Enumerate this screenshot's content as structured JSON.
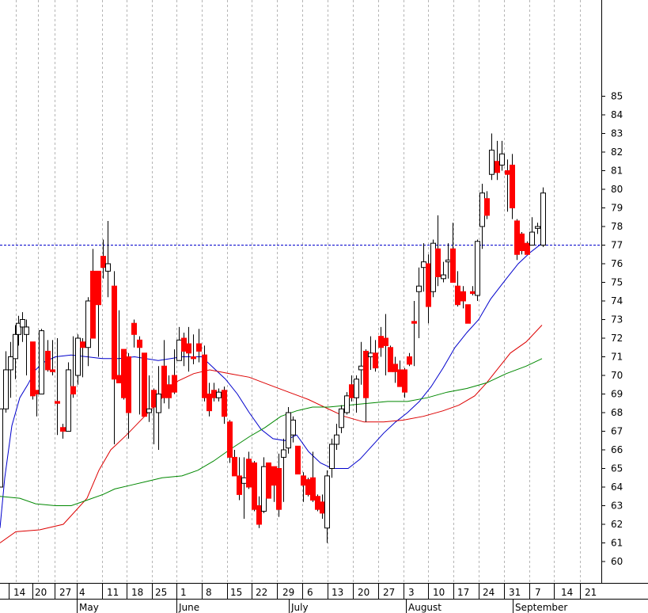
{
  "chart_data": {
    "type": "candlestick",
    "y_axis": {
      "side": "right",
      "range": [
        59,
        85.5
      ],
      "ticks": [
        60,
        61,
        62,
        63,
        64,
        65,
        66,
        67,
        68,
        69,
        70,
        71,
        72,
        73,
        74,
        75,
        76,
        77,
        78,
        79,
        80,
        81,
        82,
        83,
        84,
        85
      ]
    },
    "x_axis": {
      "ticks": [
        "14",
        "20",
        "27",
        "4",
        "11",
        "18",
        "25",
        "1",
        "8",
        "15",
        "22",
        "29",
        "6",
        "13",
        "20",
        "27",
        "3",
        "10",
        "17",
        "24",
        "31",
        "7",
        "14",
        "21"
      ],
      "months": [
        "May",
        "June",
        "July",
        "August",
        "September"
      ]
    },
    "reference_line": {
      "value": 77,
      "color": "#0000cc",
      "style": "dashed"
    },
    "series": [
      {
        "kind": "moving-average",
        "color": "#0000cc",
        "values": [
          [
            0,
            61.8
          ],
          [
            6,
            64.5
          ],
          [
            15,
            67.3
          ],
          [
            25,
            68.8
          ],
          [
            35,
            69.5
          ],
          [
            45,
            70.3
          ],
          [
            55,
            70.7
          ],
          [
            70,
            71.0
          ],
          [
            90,
            71.1
          ],
          [
            110,
            71.0
          ],
          [
            130,
            70.9
          ],
          [
            150,
            70.9
          ],
          [
            170,
            71.0
          ],
          [
            200,
            70.8
          ],
          [
            230,
            71.0
          ],
          [
            255,
            71.0
          ],
          [
            270,
            70.4
          ],
          [
            285,
            69.8
          ],
          [
            300,
            69.0
          ],
          [
            315,
            68.0
          ],
          [
            330,
            67.1
          ],
          [
            345,
            66.6
          ],
          [
            360,
            66.5
          ],
          [
            375,
            66.8
          ],
          [
            390,
            65.9
          ],
          [
            405,
            65.3
          ],
          [
            420,
            65.0
          ],
          [
            440,
            65.0
          ],
          [
            455,
            65.5
          ],
          [
            470,
            66.2
          ],
          [
            485,
            66.9
          ],
          [
            500,
            67.5
          ],
          [
            515,
            68.0
          ],
          [
            530,
            68.6
          ],
          [
            545,
            69.4
          ],
          [
            560,
            70.4
          ],
          [
            575,
            71.5
          ],
          [
            590,
            72.3
          ],
          [
            605,
            73.0
          ],
          [
            620,
            74.1
          ],
          [
            640,
            75.2
          ],
          [
            655,
            76.0
          ],
          [
            670,
            76.6
          ],
          [
            685,
            77.1
          ]
        ]
      },
      {
        "kind": "moving-average",
        "color": "#dd0000",
        "values": [
          [
            0,
            61.0
          ],
          [
            20,
            61.6
          ],
          [
            50,
            61.7
          ],
          [
            80,
            62.0
          ],
          [
            110,
            63.4
          ],
          [
            125,
            64.9
          ],
          [
            140,
            66.0
          ],
          [
            160,
            66.8
          ],
          [
            185,
            67.9
          ],
          [
            205,
            68.8
          ],
          [
            225,
            69.7
          ],
          [
            245,
            70.1
          ],
          [
            265,
            70.3
          ],
          [
            290,
            70.1
          ],
          [
            315,
            69.9
          ],
          [
            340,
            69.5
          ],
          [
            365,
            69.1
          ],
          [
            390,
            68.7
          ],
          [
            410,
            68.3
          ],
          [
            435,
            67.8
          ],
          [
            460,
            67.5
          ],
          [
            485,
            67.5
          ],
          [
            510,
            67.6
          ],
          [
            535,
            67.8
          ],
          [
            560,
            68.1
          ],
          [
            580,
            68.4
          ],
          [
            600,
            68.9
          ],
          [
            615,
            69.6
          ],
          [
            630,
            70.4
          ],
          [
            645,
            71.2
          ],
          [
            665,
            71.8
          ],
          [
            685,
            72.7
          ]
        ]
      },
      {
        "kind": "moving-average",
        "color": "#008800",
        "values": [
          [
            0,
            63.5
          ],
          [
            25,
            63.4
          ],
          [
            45,
            63.1
          ],
          [
            70,
            63.0
          ],
          [
            90,
            63.0
          ],
          [
            110,
            63.3
          ],
          [
            130,
            63.6
          ],
          [
            145,
            63.9
          ],
          [
            165,
            64.1
          ],
          [
            185,
            64.3
          ],
          [
            205,
            64.5
          ],
          [
            230,
            64.6
          ],
          [
            250,
            64.9
          ],
          [
            270,
            65.4
          ],
          [
            290,
            66.0
          ],
          [
            315,
            66.7
          ],
          [
            335,
            67.2
          ],
          [
            355,
            67.8
          ],
          [
            375,
            68.1
          ],
          [
            395,
            68.3
          ],
          [
            415,
            68.3
          ],
          [
            440,
            68.4
          ],
          [
            465,
            68.5
          ],
          [
            490,
            68.6
          ],
          [
            515,
            68.6
          ],
          [
            540,
            68.8
          ],
          [
            565,
            69.1
          ],
          [
            590,
            69.3
          ],
          [
            615,
            69.6
          ],
          [
            640,
            70.1
          ],
          [
            665,
            70.5
          ],
          [
            685,
            70.9
          ]
        ]
      }
    ],
    "candles": [
      [
        0,
        64,
        68.2,
        64,
        68.2
      ],
      [
        7,
        68.2,
        71.3,
        68.0,
        70.3
      ],
      [
        13,
        70.3,
        71.8,
        68.8,
        71.0
      ],
      [
        19,
        70.9,
        72.7,
        69.8,
        72.2
      ],
      [
        23,
        72.2,
        73.2,
        71.6,
        72.8
      ],
      [
        28,
        72.6,
        73.4,
        71.8,
        73.0
      ],
      [
        33,
        72.2,
        73.0,
        70.0,
        72.6
      ],
      [
        41,
        71.8,
        71.8,
        68.7,
        68.9
      ],
      [
        46,
        69.2,
        69.2,
        67.8,
        69.0
      ],
      [
        52,
        69.0,
        72.5,
        69.0,
        72.4
      ],
      [
        60,
        71.3,
        71.9,
        70.2,
        70.3
      ],
      [
        66,
        70.3,
        71.9,
        70.0,
        70.2
      ],
      [
        72,
        68.6,
        72.0,
        66.8,
        68.5
      ],
      [
        79,
        67.2,
        67.4,
        66.6,
        67.0
      ],
      [
        86,
        67.0,
        70.7,
        67.0,
        70.3
      ],
      [
        92,
        69.4,
        72.1,
        68.8,
        69.0
      ],
      [
        98,
        70.0,
        72.2,
        69.5,
        72.0
      ],
      [
        104,
        71.8,
        72.0,
        69.9,
        71.5
      ],
      [
        111,
        71.5,
        74.2,
        70.5,
        74.0
      ],
      [
        117,
        75.6,
        76.8,
        72.0,
        72.0
      ],
      [
        124,
        75.6,
        75.6,
        71.0,
        73.8
      ],
      [
        130,
        76.4,
        77.3,
        75.2,
        75.8
      ],
      [
        136,
        75.6,
        78.3,
        74.2,
        76.0
      ],
      [
        144,
        74.8,
        75.6,
        66.3,
        69.8
      ],
      [
        150,
        70.0,
        73.5,
        69.8,
        69.6
      ],
      [
        156,
        71.4,
        71.4,
        68.7,
        68.8
      ],
      [
        162,
        71.0,
        71.2,
        66.6,
        68.0
      ],
      [
        169,
        72.8,
        73.0,
        71.5,
        72.2
      ],
      [
        176,
        71.9,
        72.1,
        67.9,
        71.5
      ],
      [
        182,
        71.2,
        71.2,
        67.8,
        67.8
      ],
      [
        188,
        68.0,
        70.0,
        67.5,
        68.2
      ],
      [
        194,
        69.2,
        69.3,
        66.3,
        68.3
      ],
      [
        200,
        68.0,
        70.5,
        66.0,
        69.0
      ],
      [
        207,
        70.5,
        71.9,
        68.5,
        68.8
      ],
      [
        213,
        69.5,
        70.0,
        68.2,
        68.8
      ],
      [
        220,
        70.0,
        71.4,
        69.0,
        69.1
      ],
      [
        226,
        70.8,
        72.6,
        70.8,
        71.9
      ],
      [
        232,
        72.0,
        72.3,
        70.5,
        71.3
      ],
      [
        238,
        71.7,
        72.6,
        70.2,
        71.2
      ],
      [
        244,
        71.0,
        72.2,
        70.6,
        70.9
      ],
      [
        251,
        71.7,
        72.5,
        70.7,
        71.3
      ],
      [
        258,
        71.1,
        71.6,
        68.6,
        68.8
      ],
      [
        264,
        69.0,
        69.6,
        67.8,
        68.1
      ],
      [
        270,
        69.2,
        69.6,
        68.6,
        68.8
      ],
      [
        276,
        68.8,
        69.3,
        68.6,
        69.1
      ],
      [
        283,
        69.2,
        69.4,
        67.4,
        67.8
      ],
      [
        290,
        67.5,
        67.6,
        65.3,
        65.6
      ],
      [
        296,
        65.6,
        66.0,
        64.6,
        64.6
      ],
      [
        302,
        64.6,
        65.6,
        63.3,
        63.6
      ],
      [
        308,
        64.2,
        65.6,
        62.3,
        64.5
      ],
      [
        314,
        65.5,
        65.9,
        63.9,
        64.0
      ],
      [
        321,
        65.3,
        65.4,
        62.7,
        62.8
      ],
      [
        327,
        63.0,
        63.5,
        61.8,
        62.0
      ],
      [
        333,
        62.7,
        65.6,
        62.6,
        65.1
      ],
      [
        339,
        65.3,
        65.3,
        63.4,
        63.4
      ],
      [
        346,
        65.1,
        65.1,
        63.2,
        64.1
      ],
      [
        352,
        65.0,
        65.8,
        62.4,
        62.8
      ],
      [
        358,
        65.6,
        66.6,
        63.2,
        66.0
      ],
      [
        364,
        66.1,
        68.3,
        65.8,
        68.0
      ],
      [
        370,
        66.8,
        67.8,
        66.4,
        67.6
      ],
      [
        376,
        66.2,
        66.2,
        64.8,
        64.7
      ],
      [
        383,
        64.6,
        64.8,
        63.2,
        64.1
      ],
      [
        389,
        64.4,
        64.5,
        63.5,
        63.6
      ],
      [
        395,
        64.5,
        65.9,
        63.2,
        63.3
      ],
      [
        401,
        63.5,
        63.6,
        62.7,
        62.8
      ],
      [
        407,
        63.2,
        63.6,
        62.3,
        62.6
      ],
      [
        413,
        61.8,
        64.9,
        61.0,
        64.6
      ],
      [
        419,
        65.0,
        66.6,
        64.5,
        66.3
      ],
      [
        425,
        66.3,
        67.4,
        66.0,
        66.8
      ],
      [
        431,
        67.2,
        68.4,
        66.9,
        68.2
      ],
      [
        438,
        68.0,
        69.1,
        67.9,
        68.9
      ],
      [
        444,
        69.5,
        70.0,
        68.6,
        68.8
      ],
      [
        450,
        68.8,
        70.0,
        68.0,
        69.8
      ],
      [
        456,
        70.3,
        71.8,
        69.5,
        70.5
      ],
      [
        462,
        71.3,
        71.4,
        67.5,
        68.8
      ],
      [
        468,
        71.0,
        72.1,
        70.3,
        71.2
      ],
      [
        474,
        71.2,
        71.9,
        70.2,
        70.4
      ],
      [
        481,
        72.1,
        72.6,
        71.0,
        71.5
      ],
      [
        487,
        72.0,
        73.3,
        70.0,
        71.6
      ],
      [
        493,
        71.5,
        71.6,
        70.2,
        70.2
      ],
      [
        499,
        70.6,
        71.0,
        69.6,
        70.2
      ],
      [
        505,
        70.3,
        70.8,
        69.4,
        69.4
      ],
      [
        511,
        70.3,
        70.4,
        68.8,
        69.1
      ],
      [
        517,
        71.0,
        71.2,
        70.5,
        70.6
      ],
      [
        523,
        72.9,
        74.0,
        70.5,
        72.8
      ],
      [
        529,
        74.5,
        75.8,
        72.0,
        74.8
      ],
      [
        535,
        75.8,
        77.1,
        74.5,
        76.1
      ],
      [
        541,
        76.0,
        76.5,
        72.8,
        73.7
      ],
      [
        547,
        74.5,
        77.3,
        74.2,
        77.1
      ],
      [
        553,
        76.8,
        78.6,
        74.8,
        75.3
      ],
      [
        560,
        75.2,
        76.1,
        75.0,
        75.4
      ],
      [
        566,
        76.1,
        77.1,
        75.2,
        76.2
      ],
      [
        572,
        76.8,
        78.2,
        75.4,
        75.0
      ],
      [
        578,
        74.8,
        75.6,
        73.7,
        73.8
      ],
      [
        585,
        74.5,
        74.8,
        73.6,
        74.0
      ],
      [
        591,
        73.8,
        73.8,
        72.9,
        72.8
      ],
      [
        597,
        74.5,
        74.8,
        74.3,
        74.4
      ],
      [
        603,
        74.3,
        77.3,
        74.0,
        77.2
      ],
      [
        609,
        78.0,
        80.3,
        76.8,
        79.8
      ],
      [
        615,
        79.5,
        79.9,
        78.4,
        78.6
      ],
      [
        621,
        80.8,
        83.0,
        80.5,
        82.1
      ],
      [
        628,
        81.5,
        82.6,
        80.5,
        80.9
      ],
      [
        634,
        81.3,
        82.6,
        81.0,
        81.9
      ],
      [
        641,
        81.0,
        81.6,
        78.8,
        80.8
      ],
      [
        647,
        81.3,
        81.9,
        78.4,
        79.0
      ],
      [
        653,
        78.3,
        78.4,
        76.2,
        76.5
      ],
      [
        659,
        77.6,
        77.7,
        76.5,
        76.7
      ],
      [
        666,
        77.1,
        77.2,
        76.5,
        76.5
      ],
      [
        672,
        77.0,
        78.5,
        77.0,
        77.7
      ],
      [
        679,
        77.9,
        78.2,
        77.6,
        78.0
      ],
      [
        686,
        77.0,
        80.1,
        76.9,
        79.8
      ]
    ]
  }
}
